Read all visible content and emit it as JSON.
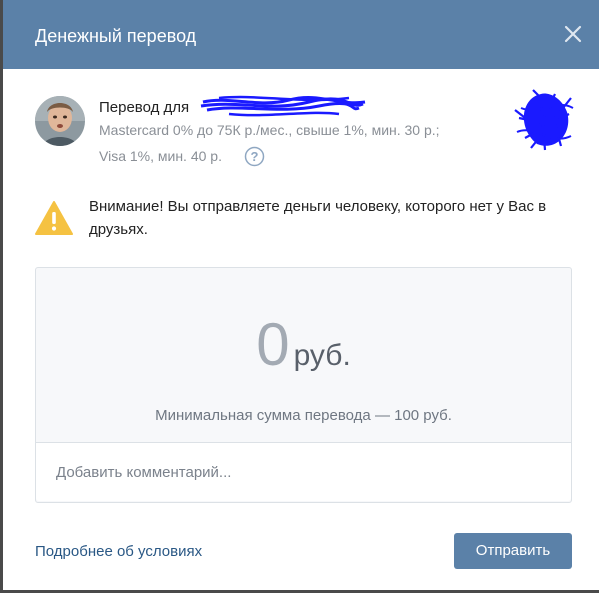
{
  "dialog": {
    "title": "Денежный перевод"
  },
  "recipient": {
    "label": "Перевод для",
    "fee_line1": "Mastercard 0% до 75К р./мес., свыше 1%, мин. 30 р.;",
    "fee_line2": "Visa 1%, мин. 40 р."
  },
  "warning": {
    "text": "Внимание! Вы отправляете деньги человеку, которого нет у Вас в друзьях."
  },
  "amount": {
    "value": "0",
    "currency": "руб.",
    "min_note": "Минимальная сумма перевода — 100 руб."
  },
  "comment": {
    "placeholder": "Добавить комментарий..."
  },
  "footer": {
    "terms_link": "Подробнее об условиях",
    "send_label": "Отправить"
  },
  "colors": {
    "header": "#5b81a8",
    "button": "#5b81a8",
    "link": "#2a5885",
    "warning": "#f5c242",
    "redaction": "#1a1aff"
  },
  "icons": {
    "close": "close-icon",
    "help": "question-circle-icon",
    "warning": "warning-triangle-icon"
  }
}
